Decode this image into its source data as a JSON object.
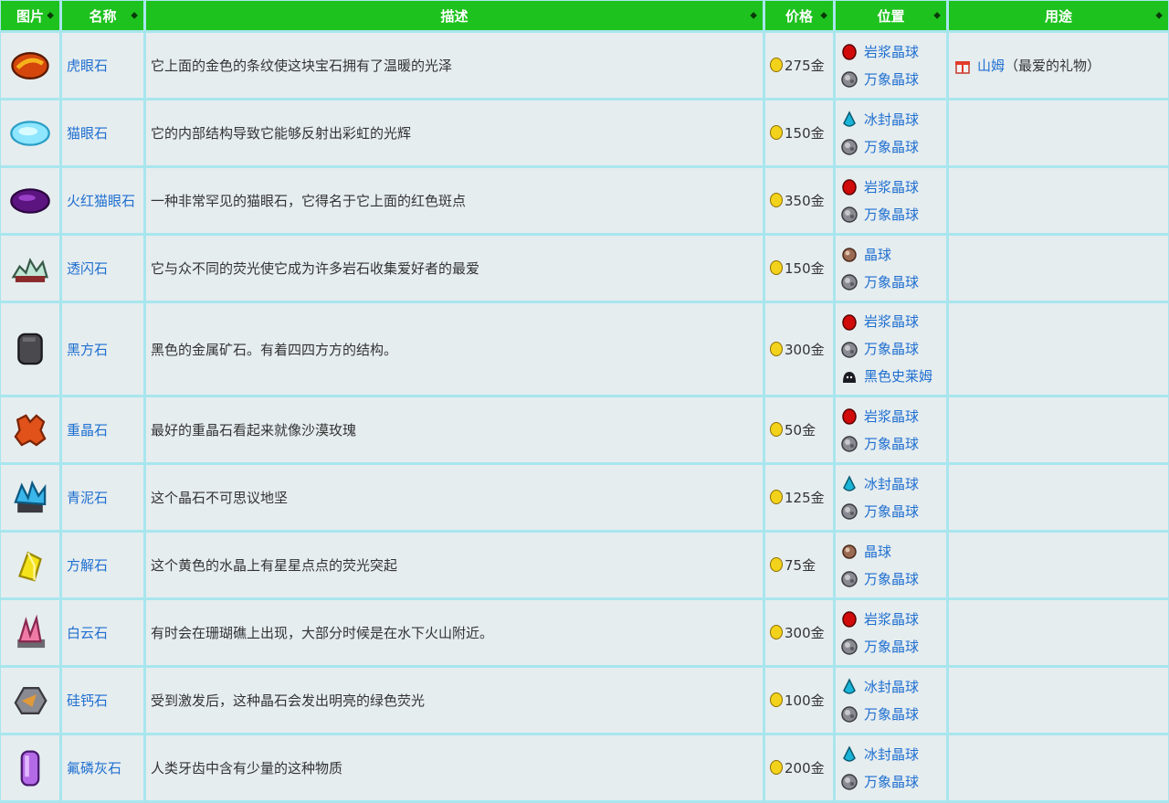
{
  "headers": {
    "image": "图片",
    "name": "名称",
    "desc": "描述",
    "price": "价格",
    "location": "位置",
    "use": "用途"
  },
  "rows": [
    {
      "name": "虎眼石",
      "desc": "它上面的金色的条纹使这块宝石拥有了温暖的光泽",
      "price": "275金",
      "icon": "tigers-eye-icon",
      "locations": [
        {
          "label": "岩浆晶球",
          "icon": "magma-geode-icon"
        },
        {
          "label": "万象晶球",
          "icon": "omni-geode-icon"
        }
      ],
      "use": {
        "label": "山姆",
        "note": "（最爱的礼物）",
        "icon": "gift-icon"
      }
    },
    {
      "name": "猫眼石",
      "desc": "它的内部结构导致它能够反射出彩虹的光辉",
      "price": "150金",
      "icon": "opal-icon",
      "locations": [
        {
          "label": "冰封晶球",
          "icon": "frozen-geode-icon"
        },
        {
          "label": "万象晶球",
          "icon": "omni-geode-icon"
        }
      ]
    },
    {
      "name": "火红猫眼石",
      "desc": "一种非常罕见的猫眼石，它得名于它上面的红色斑点",
      "price": "350金",
      "icon": "fire-opal-icon",
      "locations": [
        {
          "label": "岩浆晶球",
          "icon": "magma-geode-icon"
        },
        {
          "label": "万象晶球",
          "icon": "omni-geode-icon"
        }
      ]
    },
    {
      "name": "透闪石",
      "desc": "它与众不同的荧光使它成为许多岩石收集爱好者的最爱",
      "price": "150金",
      "icon": "tremolite-icon",
      "locations": [
        {
          "label": "晶球",
          "icon": "geode-icon"
        },
        {
          "label": "万象晶球",
          "icon": "omni-geode-icon"
        }
      ]
    },
    {
      "name": "黑方石",
      "desc": "黑色的金属矿石。有着四四方方的结构。",
      "price": "300金",
      "icon": "nekoite-icon",
      "tall": true,
      "locations": [
        {
          "label": "岩浆晶球",
          "icon": "magma-geode-icon"
        },
        {
          "label": "万象晶球",
          "icon": "omni-geode-icon"
        },
        {
          "label": "黑色史莱姆",
          "icon": "black-slime-icon"
        }
      ]
    },
    {
      "name": "重晶石",
      "desc": "最好的重晶石看起来就像沙漠玫瑰",
      "price": "50金",
      "icon": "baryte-icon",
      "locations": [
        {
          "label": "岩浆晶球",
          "icon": "magma-geode-icon"
        },
        {
          "label": "万象晶球",
          "icon": "omni-geode-icon"
        }
      ]
    },
    {
      "name": "青泥石",
      "desc": "这个晶石不可思议地坚",
      "price": "125金",
      "icon": "aerinite-icon",
      "locations": [
        {
          "label": "冰封晶球",
          "icon": "frozen-geode-icon"
        },
        {
          "label": "万象晶球",
          "icon": "omni-geode-icon"
        }
      ]
    },
    {
      "name": "方解石",
      "desc": "这个黄色的水晶上有星星点点的荧光突起",
      "price": "75金",
      "icon": "calcite-icon",
      "locations": [
        {
          "label": "晶球",
          "icon": "geode-icon"
        },
        {
          "label": "万象晶球",
          "icon": "omni-geode-icon"
        }
      ]
    },
    {
      "name": "白云石",
      "desc": "有时会在珊瑚礁上出现，大部分时候是在水下火山附近。",
      "price": "300金",
      "icon": "dolomite-icon",
      "locations": [
        {
          "label": "岩浆晶球",
          "icon": "magma-geode-icon"
        },
        {
          "label": "万象晶球",
          "icon": "omni-geode-icon"
        }
      ]
    },
    {
      "name": "硅钙石",
      "desc": "受到激发后，这种晶石会发出明亮的绿色荧光",
      "price": "100金",
      "icon": "esperite-icon",
      "locations": [
        {
          "label": "冰封晶球",
          "icon": "frozen-geode-icon"
        },
        {
          "label": "万象晶球",
          "icon": "omni-geode-icon"
        }
      ]
    },
    {
      "name": "氟磷灰石",
      "desc": "人类牙齿中含有少量的这种物质",
      "price": "200金",
      "icon": "fluorapatite-icon",
      "locations": [
        {
          "label": "冰封晶球",
          "icon": "frozen-geode-icon"
        },
        {
          "label": "万象晶球",
          "icon": "omni-geode-icon"
        }
      ]
    }
  ]
}
